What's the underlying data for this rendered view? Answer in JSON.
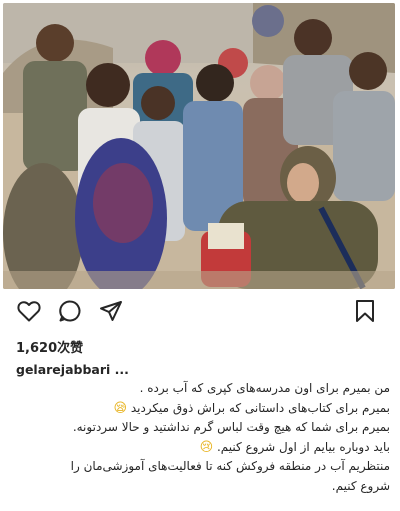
{
  "post": {
    "image": {
      "description": "",
      "alt": ""
    },
    "actions": {
      "like": "heart-icon",
      "comment": "comment-icon",
      "share": "send-icon",
      "save": "bookmark-icon"
    },
    "likes_text": "1,620次赞",
    "username": "gelarejabbari ...",
    "caption_lines": [
      "من بمیرم برای اون مدرسه‌های کپری که آب برده .",
      "بمیرم برای کتاب‌های داستانی که براش ذوق میکردید",
      "بمیرم برای شما که هیچ وقت لباس گرم نداشتید و حالا سردتونه.",
      "باید دوباره بیایم از اول شروع کنیم.",
      "منتظریم آب در منطقه فروکش کنه تا فعالیت‌های آموزشی‌مان را",
      "شروع کنیم."
    ],
    "emojis": {
      "line2": "😪",
      "line4": "😢"
    }
  },
  "colors": {
    "text": "#262626",
    "background": "#ffffff"
  }
}
